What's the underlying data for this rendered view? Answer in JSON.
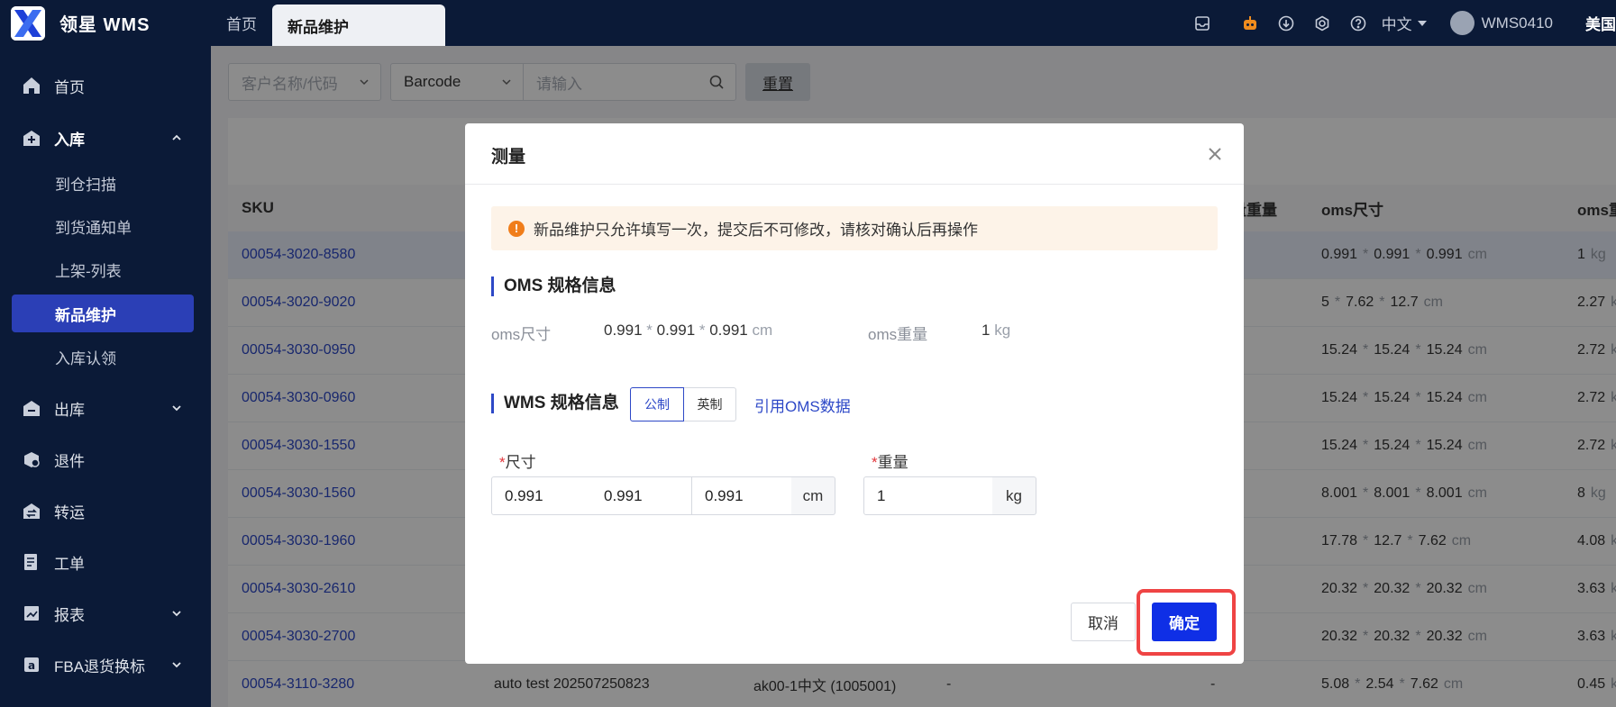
{
  "app": {
    "title": "领星 WMS"
  },
  "top_tabs": [
    {
      "label": "首页"
    },
    {
      "label": "新品维护"
    }
  ],
  "top_right": {
    "language": "中文",
    "username": "WMS0410",
    "region": "美国"
  },
  "sidebar": {
    "items": [
      {
        "label": "首页",
        "icon": "home-icon"
      },
      {
        "label": "入库",
        "icon": "inbound-icon"
      },
      {
        "label": "出库",
        "icon": "outbound-icon"
      },
      {
        "label": "退件",
        "icon": "return-icon"
      },
      {
        "label": "转运",
        "icon": "transfer-icon"
      },
      {
        "label": "工单",
        "icon": "workorder-icon"
      },
      {
        "label": "报表",
        "icon": "report-icon"
      },
      {
        "label": "FBA退货换标",
        "icon": "fba-icon"
      }
    ],
    "inbound_sub": [
      {
        "label": "到仓扫描"
      },
      {
        "label": "到货通知单"
      },
      {
        "label": "上架-列表"
      },
      {
        "label": "新品维护"
      },
      {
        "label": "入库认领"
      }
    ]
  },
  "filter": {
    "customer_placeholder": "客户名称/代码",
    "type_value": "Barcode",
    "search_placeholder": "请输入",
    "reset_label": "重置"
  },
  "table": {
    "columns": {
      "sku": "SKU",
      "wms_weight": "量重量",
      "oms_size": "oms尺寸",
      "oms_weight": "oms重"
    },
    "rows": [
      {
        "sku": "00054-3020-8580",
        "oms_size": [
          "0.991",
          "0.991",
          "0.991"
        ],
        "oms_weight": "1"
      },
      {
        "sku": "00054-3020-9020",
        "oms_size": [
          "5",
          "7.62",
          "12.7"
        ],
        "oms_weight": "2.27"
      },
      {
        "sku": "00054-3030-0950",
        "oms_size": [
          "15.24",
          "15.24",
          "15.24"
        ],
        "oms_weight": "2.72"
      },
      {
        "sku": "00054-3030-0960",
        "oms_size": [
          "15.24",
          "15.24",
          "15.24"
        ],
        "oms_weight": "2.72"
      },
      {
        "sku": "00054-3030-1550",
        "oms_size": [
          "15.24",
          "15.24",
          "15.24"
        ],
        "oms_weight": "2.72"
      },
      {
        "sku": "00054-3030-1560",
        "oms_size": [
          "8.001",
          "8.001",
          "8.001"
        ],
        "oms_weight": "8"
      },
      {
        "sku": "00054-3030-1960",
        "oms_size": [
          "17.78",
          "12.7",
          "7.62"
        ],
        "oms_weight": "4.08"
      },
      {
        "sku": "00054-3030-2610",
        "oms_size": [
          "20.32",
          "20.32",
          "20.32"
        ],
        "oms_weight": "3.63"
      },
      {
        "sku": "00054-3030-2700",
        "oms_size": [
          "20.32",
          "20.32",
          "20.32"
        ],
        "oms_weight": "3.63"
      },
      {
        "sku": "00054-3110-3280",
        "name": "auto test 202507250823",
        "customer": "ak00-1中文 (1005001)",
        "dash1": "-",
        "dash2": "-",
        "oms_size": [
          "5.08",
          "2.54",
          "7.62"
        ],
        "oms_weight": "0.45"
      }
    ],
    "size_unit": "cm",
    "size_sep": "*",
    "weight_unit": "kg"
  },
  "modal": {
    "title": "测量",
    "alert": "新品维护只允许填写一次，提交后不可修改，请核对确认后再操作",
    "oms_section": "OMS 规格信息",
    "oms_size_label": "oms尺寸",
    "oms_size": [
      "0.991",
      "0.991",
      "0.991"
    ],
    "oms_size_unit": "cm",
    "oms_weight_label": "oms重量",
    "oms_weight": "1",
    "oms_weight_unit": "kg",
    "wms_section": "WMS 规格信息",
    "metric_label": "公制",
    "imperial_label": "英制",
    "cite_link": "引用OMS数据",
    "size_label": "尺寸",
    "weight_label": "重量",
    "length": "0.991",
    "width": "0.991",
    "height": "0.991",
    "size_unit": "cm",
    "weight": "1",
    "weight_unit": "kg",
    "cancel_label": "取消",
    "ok_label": "确定"
  }
}
